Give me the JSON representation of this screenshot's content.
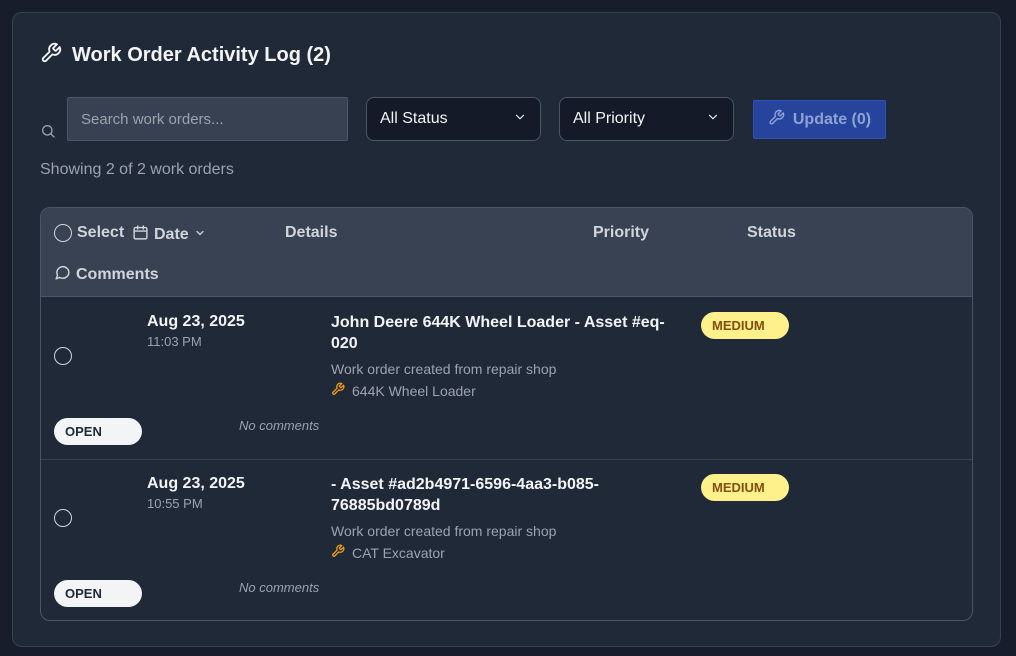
{
  "header": {
    "title": "Work Order Activity Log (2)",
    "icon": "wrench-icon"
  },
  "filters": {
    "search_placeholder": "Search work orders...",
    "search_value": "",
    "status_selected": "All Status",
    "priority_selected": "All Priority",
    "update_label": "Update (0)"
  },
  "summary": "Showing 2 of 2 work orders",
  "table": {
    "columns": {
      "select": "Select",
      "date": "Date",
      "details": "Details",
      "priority": "Priority",
      "status": "Status",
      "comments": "Comments"
    },
    "rows": [
      {
        "date": "Aug 23, 2025",
        "time": "11:03 PM",
        "title_line1": "John Deere 644K Wheel Loader - Asset #eq-",
        "title_line2": "020",
        "description": "Work order created from repair shop",
        "asset": "644K Wheel Loader",
        "priority": "MEDIUM",
        "status": "OPEN",
        "comments": "No comments"
      },
      {
        "date": "Aug 23, 2025",
        "time": "10:55 PM",
        "title_line1": "- Asset #ad2b4971-6596-4aa3-b085-",
        "title_line2": "76885bd0789d",
        "description": "Work order created from repair shop",
        "asset": "CAT Excavator",
        "priority": "MEDIUM",
        "status": "OPEN",
        "comments": "No comments"
      }
    ]
  },
  "colors": {
    "background": "#171d2b",
    "card": "#202938",
    "accent_button": "#26449b",
    "medium_badge": "#fef08a",
    "asset_icon": "#f59e0b"
  }
}
